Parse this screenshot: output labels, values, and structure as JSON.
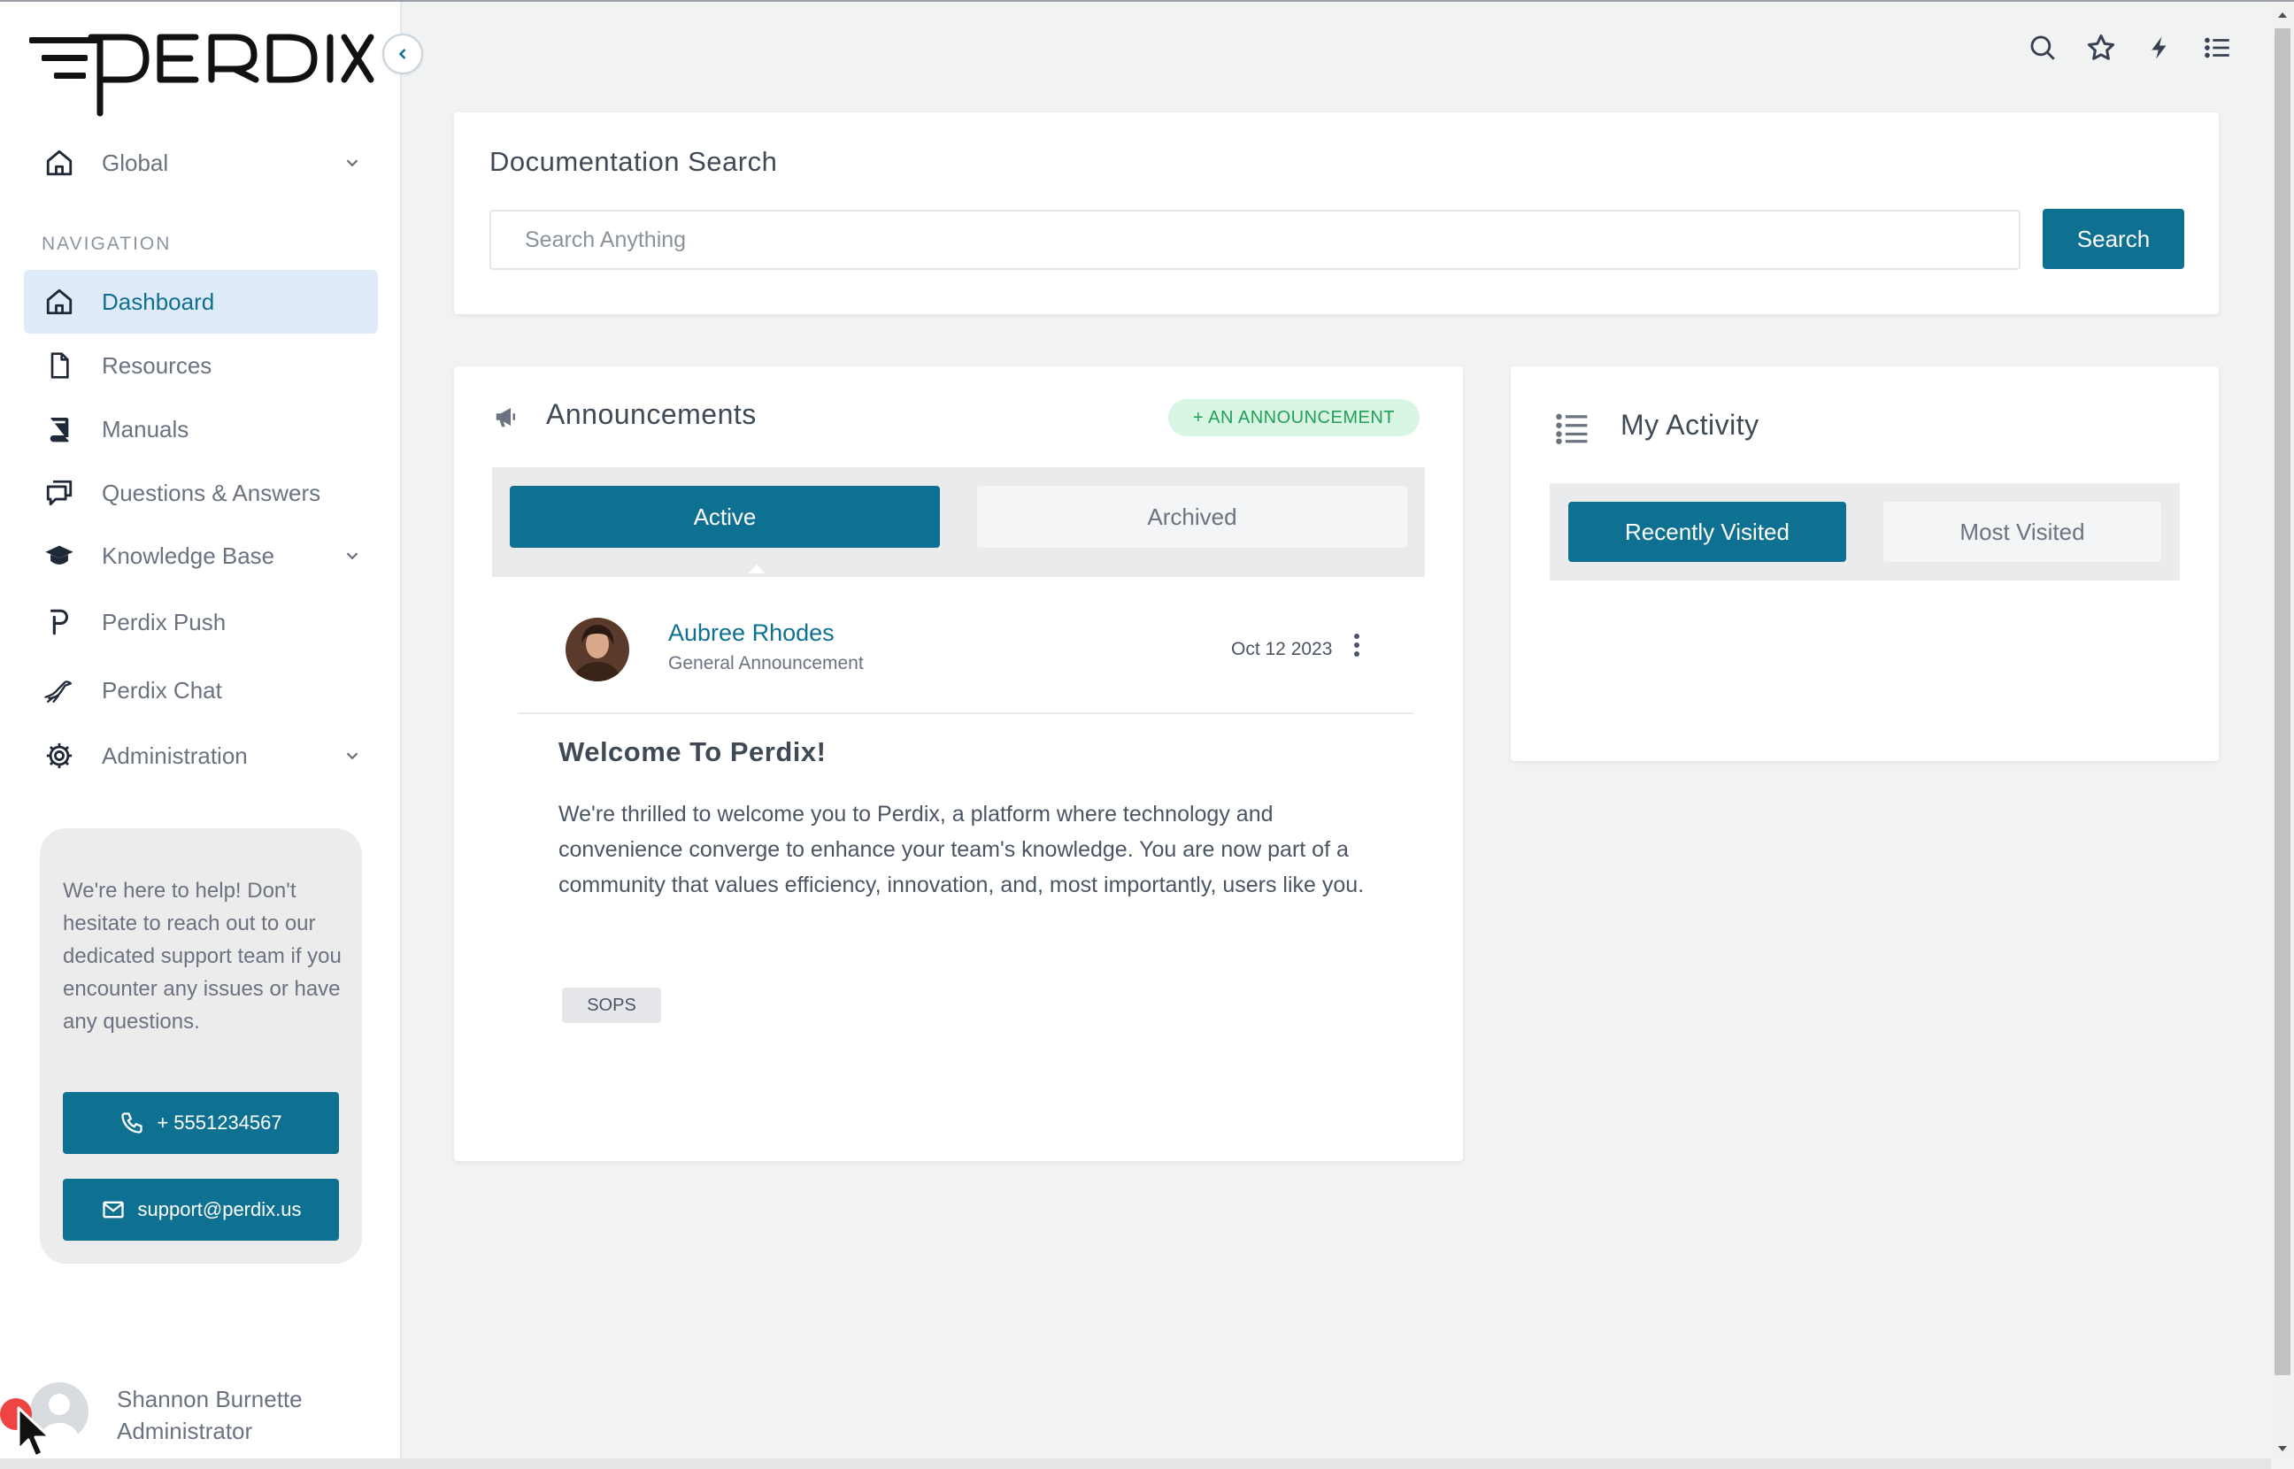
{
  "app": {
    "brand": "PERDIX"
  },
  "sidebar": {
    "workspace_label": "Global",
    "nav_heading": "NAVIGATION",
    "items": [
      {
        "label": "Dashboard",
        "icon": "home-icon",
        "active": true
      },
      {
        "label": "Resources",
        "icon": "file-icon"
      },
      {
        "label": "Manuals",
        "icon": "book-icon"
      },
      {
        "label": "Questions & Answers",
        "icon": "chat-bubbles-icon"
      },
      {
        "label": "Knowledge Base",
        "icon": "graduation-cap-icon",
        "expandable": true
      },
      {
        "label": "Perdix Push",
        "icon": "perdix-p-icon"
      },
      {
        "label": "Perdix Chat",
        "icon": "bird-icon"
      },
      {
        "label": "Administration",
        "icon": "gear-icon",
        "expandable": true
      }
    ],
    "help": {
      "text": "We're here to help! Don't hesitate to reach out to our dedicated support team if you encounter any issues or have any questions.",
      "phone": "+ 5551234567",
      "email": "support@perdix.us"
    },
    "user": {
      "name": "Shannon Burnette",
      "role": "Administrator"
    }
  },
  "topbar": {
    "icons": [
      "search-icon",
      "star-icon",
      "bolt-icon",
      "list-icon"
    ]
  },
  "doc_search": {
    "title": "Documentation Search",
    "placeholder": "Search Anything",
    "button_label": "Search"
  },
  "announcements": {
    "title": "Announcements",
    "add_label": "+ AN ANNOUNCEMENT",
    "tabs": {
      "active": "Active",
      "archived": "Archived"
    },
    "post": {
      "author": "Aubree Rhodes",
      "category": "General Announcement",
      "date": "Oct 12 2023",
      "heading": "Welcome To Perdix!",
      "body": "We're thrilled to welcome you to Perdix, a platform where technology and convenience converge to enhance your team's knowledge. You are now part of a community that values efficiency, innovation, and, most importantly, users like you.",
      "tag": "SOPS"
    }
  },
  "activity": {
    "title": "My Activity",
    "tabs": {
      "recent": "Recently Visited",
      "most": "Most Visited"
    }
  },
  "colors": {
    "primary": "#0f7191",
    "active_bg": "#e0ebfa",
    "success_bg": "#d9f5e4",
    "success_text": "#22a05a",
    "page_bg": "#f1f2f2"
  }
}
